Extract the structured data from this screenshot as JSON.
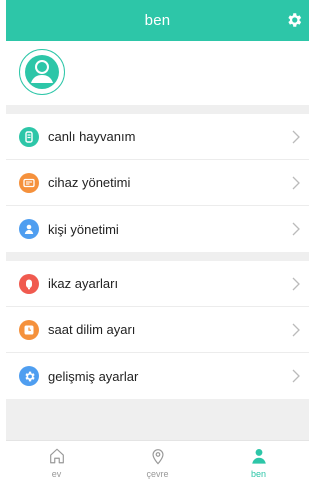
{
  "header": {
    "title": "ben",
    "settings_icon": "gear-icon"
  },
  "profile": {
    "avatar_icon": "user-avatar-icon",
    "accent": "#2dc6a8"
  },
  "menu_group_1": [
    {
      "label": "canlı hayvanım",
      "icon": "pet-collar-icon",
      "color": "#2dc6a8"
    },
    {
      "label": "cihaz yönetimi",
      "icon": "device-card-icon",
      "color": "#f5913c"
    },
    {
      "label": "kişi yönetimi",
      "icon": "person-icon",
      "color": "#4f9ef0"
    }
  ],
  "menu_group_2": [
    {
      "label": "ikaz ayarları",
      "icon": "alarm-bell-icon",
      "color": "#f05a4f"
    },
    {
      "label": "saat dilim ayarı",
      "icon": "clock-icon",
      "color": "#f5913c"
    },
    {
      "label": "gelişmiş ayarlar",
      "icon": "gear-icon",
      "color": "#4f9ef0"
    }
  ],
  "tabbar": [
    {
      "label": "ev",
      "icon": "home-icon",
      "active": false
    },
    {
      "label": "çevre",
      "icon": "location-pin-icon",
      "active": false
    },
    {
      "label": "ben",
      "icon": "person-icon",
      "active": true
    }
  ]
}
